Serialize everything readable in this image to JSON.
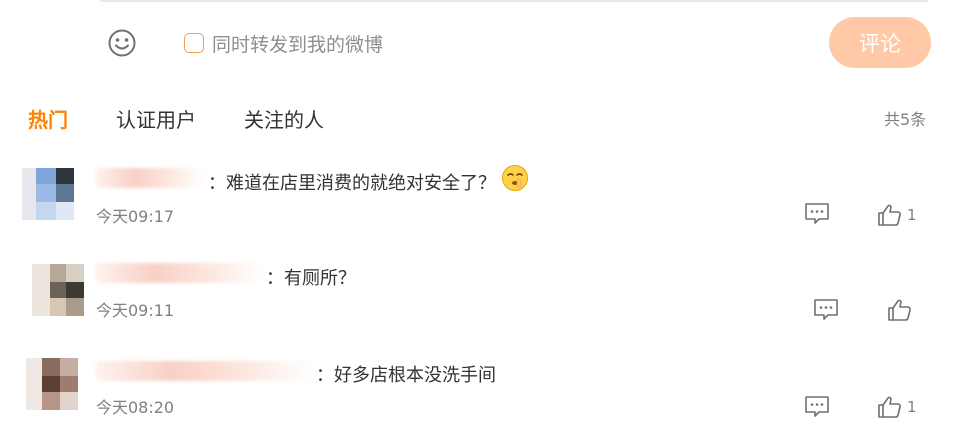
{
  "composer": {
    "repost_label": "同时转发到我的微博",
    "submit_label": "评论"
  },
  "tabs": [
    {
      "label": "热门",
      "active": true
    },
    {
      "label": "认证用户",
      "active": false
    },
    {
      "label": "关注的人",
      "active": false
    }
  ],
  "total_label": "共5条",
  "comments": [
    {
      "username": "",
      "text": "：难道在店里消费的就绝对安全了？",
      "emoji": "shh-face-icon",
      "time": "今天09:17",
      "likes": "1"
    },
    {
      "username": "",
      "text": "：有厕所？",
      "time": "今天09:11",
      "likes": ""
    },
    {
      "username": "",
      "text": "：好多店根本没洗手间",
      "time": "今天08:20",
      "likes": "1"
    }
  ],
  "colors": {
    "accent": "#ff8200",
    "submit_bg": "#ffc9a8",
    "muted": "#808080"
  }
}
